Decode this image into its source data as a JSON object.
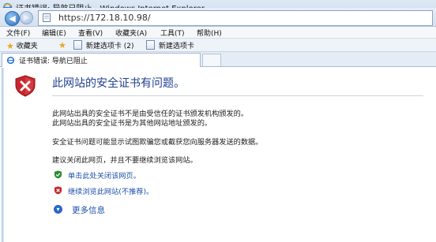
{
  "window": {
    "title": "证书错误: 导航已阻止 - Windows Internet Explorer"
  },
  "address": {
    "url": "https://172.18.10.98/"
  },
  "menu": {
    "items": [
      "文件(F)",
      "编辑(E)",
      "查看(V)",
      "收藏夹(A)",
      "工具(T)",
      "帮助(H)"
    ]
  },
  "favorites": {
    "label": "收藏夹",
    "items": [
      "新建选项卡 (2)",
      "新建选项卡"
    ]
  },
  "tab": {
    "label": "证书错误: 导航已阻止"
  },
  "page": {
    "heading": "此网站的安全证书有问题。",
    "para1_line1": "此网站出具的安全证书不是由受信任的证书颁发机构颁发的。",
    "para1_line2": "此网站出具的安全证书是为其他网站地址颁发的。",
    "para2": "安全证书问题可能显示试图欺骗您或截获您向服务器发送的数据。",
    "para3": "建议关闭此网页，并且不要继续浏览该网站。",
    "close_link": "单击此处关闭该网页。",
    "continue_link": "继续浏览此网站(不推荐)。",
    "more_info": "更多信息"
  },
  "colors": {
    "link": "#1d4faa",
    "heading": "#1f3f91",
    "shield_red": "#c8262b",
    "check_green": "#2e8b2e"
  }
}
